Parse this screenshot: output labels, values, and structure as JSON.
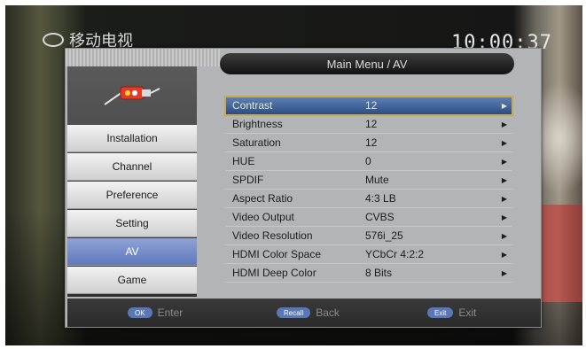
{
  "header": {
    "title": "Main Menu / AV"
  },
  "overlay": {
    "channel_logo_text": "移动电视",
    "clock": "10:00:37"
  },
  "sidebar": {
    "items": [
      {
        "label": "Installation",
        "active": false
      },
      {
        "label": "Channel",
        "active": false
      },
      {
        "label": "Preference",
        "active": false
      },
      {
        "label": "Setting",
        "active": false
      },
      {
        "label": "AV",
        "active": true
      },
      {
        "label": "Game",
        "active": false
      }
    ]
  },
  "settings": [
    {
      "label": "Contrast",
      "value": "12",
      "selected": true
    },
    {
      "label": "Brightness",
      "value": "12",
      "selected": false
    },
    {
      "label": "Saturation",
      "value": "12",
      "selected": false
    },
    {
      "label": "HUE",
      "value": "0",
      "selected": false
    },
    {
      "label": "SPDIF",
      "value": "Mute",
      "selected": false
    },
    {
      "label": "Aspect Ratio",
      "value": "4:3 LB",
      "selected": false
    },
    {
      "label": "Video Output",
      "value": "CVBS",
      "selected": false
    },
    {
      "label": "Video Resolution",
      "value": "576i_25",
      "selected": false
    },
    {
      "label": "HDMI Color Space",
      "value": "YCbCr 4:2:2",
      "selected": false
    },
    {
      "label": "HDMI Deep Color",
      "value": "8 Bits",
      "selected": false
    }
  ],
  "footer": {
    "ok_key": "OK",
    "ok_label": "Enter",
    "recall_key": "Recall",
    "recall_label": "Back",
    "exit_key": "Exit",
    "exit_label": "Exit"
  },
  "colors": {
    "accent": "#5f79bb",
    "selected_row": "#2b4d84",
    "highlight_outline": "#c9a94a"
  },
  "icons": {
    "av_cable": "av-cable-icon",
    "arrow": "arrow-right-icon"
  }
}
